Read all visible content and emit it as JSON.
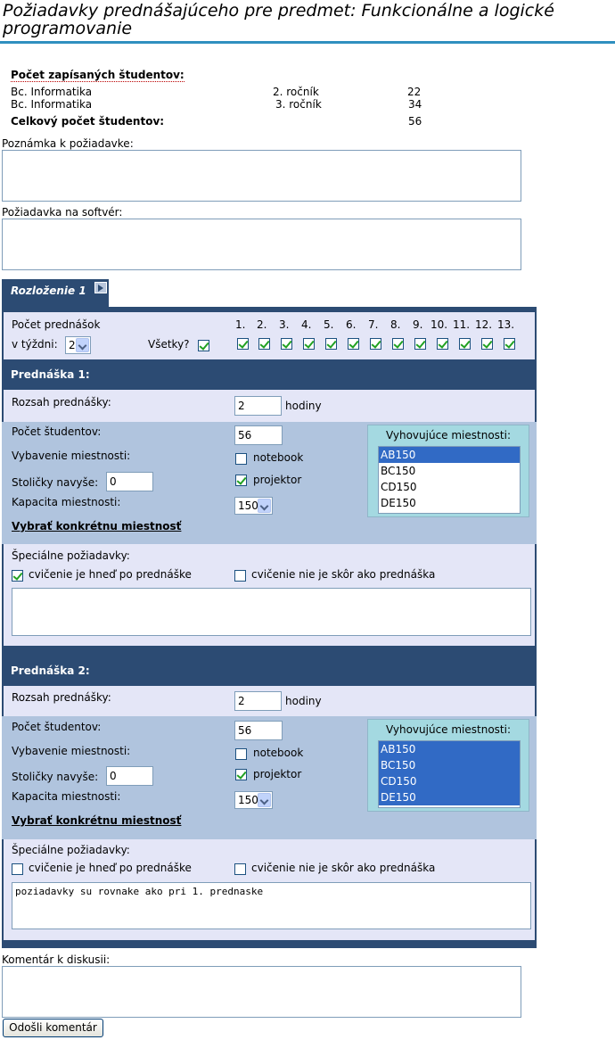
{
  "page": {
    "title": "Požiadavky prednášajúceho pre predmet: Funkcionálne a logické programovanie"
  },
  "stats": {
    "enrolled_label": "Počet zapísaných študentov:",
    "rows": [
      {
        "program": "Bc. Informatika",
        "year": "2. ročník",
        "count": "22"
      },
      {
        "program": "Bc. Informatika",
        "year": "3. ročník",
        "count": "34"
      }
    ],
    "total_label": "Celkový počet študentov:",
    "total": "56"
  },
  "request_note": {
    "label": "Poznámka k požiadavke:",
    "value": ""
  },
  "software": {
    "label": "Požiadavka na softvér:",
    "value": ""
  },
  "layout_tab": {
    "label": "Rozloženie 1"
  },
  "weekly": {
    "count_label": "Počet prednášok",
    "per_week_label": "v týždni:",
    "per_week_value": "2",
    "all_label": "Všetky?",
    "all_checked": true,
    "weeks": [
      "1.",
      "2.",
      "3.",
      "4.",
      "5.",
      "6.",
      "7.",
      "8.",
      "9.",
      "10.",
      "11.",
      "12.",
      "13."
    ]
  },
  "lectures": [
    {
      "header": "Prednáška 1:",
      "range_label": "Rozsah prednášky:",
      "range_value": "2",
      "range_unit": "hodiny",
      "students_label": "Počet študentov:",
      "students_value": "56",
      "equipment_label": "Vybavenie miestnosti:",
      "notebook_label": "notebook",
      "notebook_checked": false,
      "projector_label": "projektor",
      "projector_checked": true,
      "chairs_label": "Stoličky navyše:",
      "chairs_value": "0",
      "capacity_label": "Kapacita miestnosti:",
      "capacity_value": "150",
      "choose_room_link": "Vybrať konkrétnu miestnosť",
      "rooms_title": "Vyhovujúce miestnosti:",
      "rooms": [
        "AB150",
        "BC150",
        "CD150",
        "DE150"
      ],
      "rooms_selected": [
        true,
        false,
        false,
        false
      ],
      "special_label": "Špeciálne požiadavky:",
      "exercise_after_label": "cvičenie je hneď po prednáške",
      "exercise_after_checked": true,
      "exercise_not_before_label": "cvičenie nie je skôr ako prednáška",
      "exercise_not_before_checked": false,
      "special_text": ""
    },
    {
      "header": "Prednáška 2:",
      "range_label": "Rozsah prednášky:",
      "range_value": "2",
      "range_unit": "hodiny",
      "students_label": "Počet študentov:",
      "students_value": "56",
      "equipment_label": "Vybavenie miestnosti:",
      "notebook_label": "notebook",
      "notebook_checked": false,
      "projector_label": "projektor",
      "projector_checked": true,
      "chairs_label": "Stoličky navyše:",
      "chairs_value": "0",
      "capacity_label": "Kapacita miestnosti:",
      "capacity_value": "150",
      "choose_room_link": "Vybrať konkrétnu miestnosť",
      "rooms_title": "Vyhovujúce miestnosti:",
      "rooms": [
        "AB150",
        "BC150",
        "CD150",
        "DE150"
      ],
      "rooms_selected": [
        true,
        true,
        true,
        true
      ],
      "special_label": "Špeciálne požiadavky:",
      "exercise_after_label": "cvičenie je hneď po prednáške",
      "exercise_after_checked": false,
      "exercise_not_before_label": "cvičenie nie je skôr ako prednáška",
      "exercise_not_before_checked": false,
      "special_text": "poziadavky su rovnake ako pri 1. prednaske"
    }
  ],
  "discussion": {
    "label": "Komentár k diskusii:",
    "value": "",
    "submit_label": "Odošli komentár"
  },
  "colors": {
    "header_bg": "#2c4b73",
    "panel_bg": "#e4e6f7",
    "band_bg": "#b0c4de",
    "rooms_bg": "#a4d9e1",
    "title_rule": "#2f8fbf"
  }
}
